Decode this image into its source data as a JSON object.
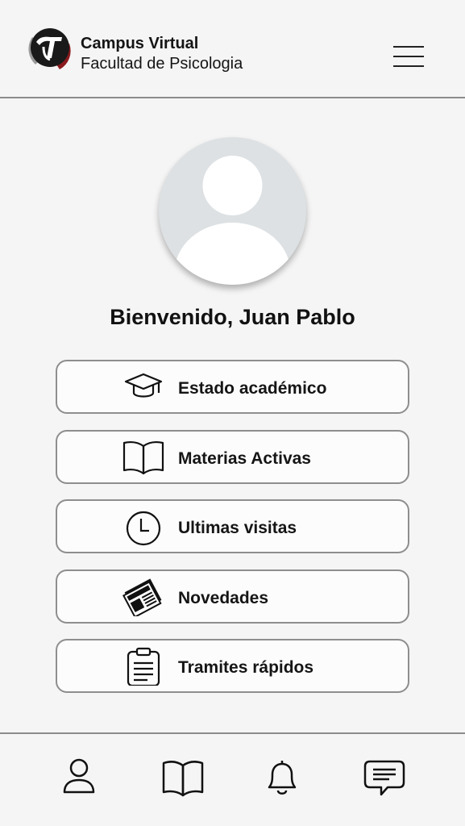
{
  "header": {
    "title": "Campus Virtual",
    "subtitle": "Facultad de Psicologia",
    "logo_icon": "university-logo",
    "menu_icon": "hamburger-menu-icon"
  },
  "profile": {
    "avatar_icon": "user-avatar-placeholder",
    "welcome": "Bienvenido, Juan Pablo"
  },
  "menu": {
    "items": [
      {
        "label": "Estado académico",
        "icon": "graduation-cap-icon"
      },
      {
        "label": "Materias Activas",
        "icon": "open-book-icon"
      },
      {
        "label": "Ultimas visitas",
        "icon": "clock-icon"
      },
      {
        "label": "Novedades",
        "icon": "newspaper-icon"
      },
      {
        "label": "Tramites rápidos",
        "icon": "clipboard-icon"
      }
    ]
  },
  "bottom_nav": {
    "items": [
      {
        "icon": "user-icon"
      },
      {
        "icon": "book-icon"
      },
      {
        "icon": "bell-icon"
      },
      {
        "icon": "chat-icon"
      }
    ]
  },
  "colors": {
    "background": "#f5f5f5",
    "border": "#8e8e8e",
    "logo_dark": "#1a1a1a",
    "logo_red": "#8b1a1e",
    "avatar_bg": "#dde1e3"
  }
}
